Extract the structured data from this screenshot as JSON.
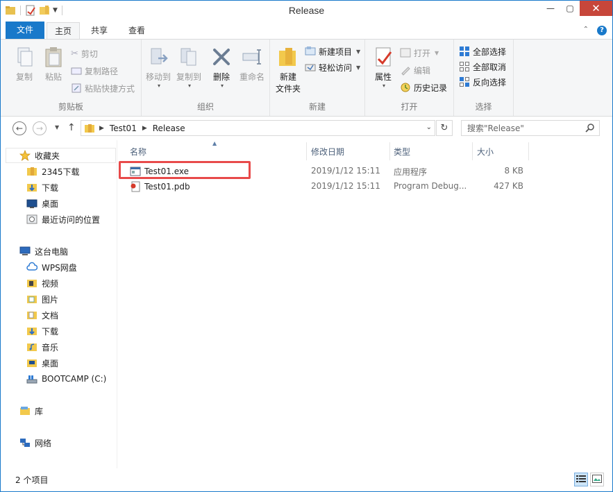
{
  "window": {
    "title": "Release"
  },
  "ribbon_tabs": {
    "file": "文件",
    "home": "主页",
    "share": "共享",
    "view": "查看"
  },
  "ribbon": {
    "clipboard": {
      "label": "剪贴板",
      "copy": "复制",
      "paste": "粘贴",
      "cut": "剪切",
      "copy_path": "复制路径",
      "paste_shortcut": "粘贴快捷方式"
    },
    "organize": {
      "label": "组织",
      "move_to": "移动到",
      "copy_to": "复制到",
      "delete": "删除",
      "rename": "重命名"
    },
    "new": {
      "label": "新建",
      "new_folder_line1": "新建",
      "new_folder_line2": "文件夹",
      "new_item": "新建项目",
      "easy_access": "轻松访问"
    },
    "open": {
      "label": "打开",
      "properties": "属性",
      "open": "打开",
      "edit": "编辑",
      "history": "历史记录"
    },
    "select": {
      "label": "选择",
      "select_all": "全部选择",
      "select_none": "全部取消",
      "invert": "反向选择"
    }
  },
  "address": {
    "crumbs": [
      "Test01",
      "Release"
    ],
    "search_placeholder": "搜索\"Release\""
  },
  "nav": {
    "favorites": "收藏夹",
    "fav_items": [
      "2345下载",
      "下载",
      "桌面",
      "最近访问的位置"
    ],
    "this_pc": "这台电脑",
    "pc_items": [
      "WPS网盘",
      "视频",
      "图片",
      "文档",
      "下载",
      "音乐",
      "桌面",
      "BOOTCAMP (C:)"
    ],
    "libraries": "库",
    "network": "网络"
  },
  "columns": {
    "name": "名称",
    "date": "修改日期",
    "type": "类型",
    "size": "大小"
  },
  "files": [
    {
      "name": "Test01.exe",
      "date": "2019/1/12 15:11",
      "type": "应用程序",
      "size": "8 KB"
    },
    {
      "name": "Test01.pdb",
      "date": "2019/1/12 15:11",
      "type": "Program Debug...",
      "size": "427 KB"
    }
  ],
  "status": {
    "count_text": "2 个项目"
  },
  "colors": {
    "accent": "#1979ca",
    "highlight": "#e84a4a",
    "close": "#c7463a"
  }
}
